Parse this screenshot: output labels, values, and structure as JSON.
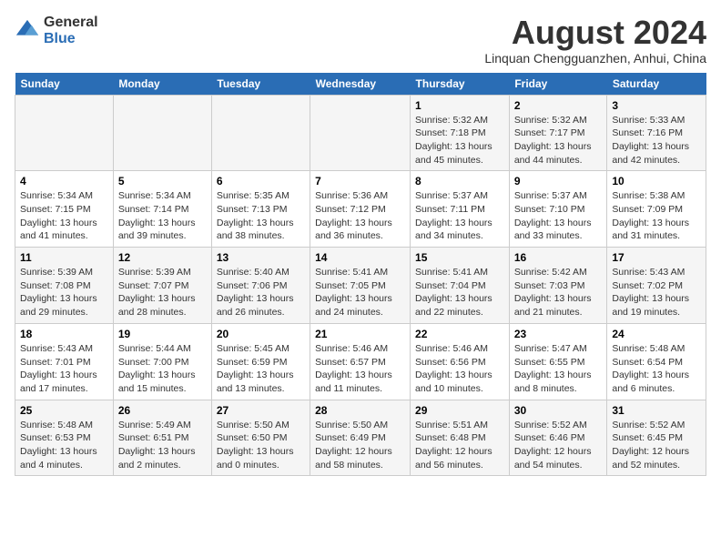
{
  "logo": {
    "general": "General",
    "blue": "Blue"
  },
  "title": {
    "month_year": "August 2024",
    "location": "Linquan Chengguanzhen, Anhui, China"
  },
  "headers": [
    "Sunday",
    "Monday",
    "Tuesday",
    "Wednesday",
    "Thursday",
    "Friday",
    "Saturday"
  ],
  "weeks": [
    [
      {
        "day": "",
        "detail": ""
      },
      {
        "day": "",
        "detail": ""
      },
      {
        "day": "",
        "detail": ""
      },
      {
        "day": "",
        "detail": ""
      },
      {
        "day": "1",
        "detail": "Sunrise: 5:32 AM\nSunset: 7:18 PM\nDaylight: 13 hours\nand 45 minutes."
      },
      {
        "day": "2",
        "detail": "Sunrise: 5:32 AM\nSunset: 7:17 PM\nDaylight: 13 hours\nand 44 minutes."
      },
      {
        "day": "3",
        "detail": "Sunrise: 5:33 AM\nSunset: 7:16 PM\nDaylight: 13 hours\nand 42 minutes."
      }
    ],
    [
      {
        "day": "4",
        "detail": "Sunrise: 5:34 AM\nSunset: 7:15 PM\nDaylight: 13 hours\nand 41 minutes."
      },
      {
        "day": "5",
        "detail": "Sunrise: 5:34 AM\nSunset: 7:14 PM\nDaylight: 13 hours\nand 39 minutes."
      },
      {
        "day": "6",
        "detail": "Sunrise: 5:35 AM\nSunset: 7:13 PM\nDaylight: 13 hours\nand 38 minutes."
      },
      {
        "day": "7",
        "detail": "Sunrise: 5:36 AM\nSunset: 7:12 PM\nDaylight: 13 hours\nand 36 minutes."
      },
      {
        "day": "8",
        "detail": "Sunrise: 5:37 AM\nSunset: 7:11 PM\nDaylight: 13 hours\nand 34 minutes."
      },
      {
        "day": "9",
        "detail": "Sunrise: 5:37 AM\nSunset: 7:10 PM\nDaylight: 13 hours\nand 33 minutes."
      },
      {
        "day": "10",
        "detail": "Sunrise: 5:38 AM\nSunset: 7:09 PM\nDaylight: 13 hours\nand 31 minutes."
      }
    ],
    [
      {
        "day": "11",
        "detail": "Sunrise: 5:39 AM\nSunset: 7:08 PM\nDaylight: 13 hours\nand 29 minutes."
      },
      {
        "day": "12",
        "detail": "Sunrise: 5:39 AM\nSunset: 7:07 PM\nDaylight: 13 hours\nand 28 minutes."
      },
      {
        "day": "13",
        "detail": "Sunrise: 5:40 AM\nSunset: 7:06 PM\nDaylight: 13 hours\nand 26 minutes."
      },
      {
        "day": "14",
        "detail": "Sunrise: 5:41 AM\nSunset: 7:05 PM\nDaylight: 13 hours\nand 24 minutes."
      },
      {
        "day": "15",
        "detail": "Sunrise: 5:41 AM\nSunset: 7:04 PM\nDaylight: 13 hours\nand 22 minutes."
      },
      {
        "day": "16",
        "detail": "Sunrise: 5:42 AM\nSunset: 7:03 PM\nDaylight: 13 hours\nand 21 minutes."
      },
      {
        "day": "17",
        "detail": "Sunrise: 5:43 AM\nSunset: 7:02 PM\nDaylight: 13 hours\nand 19 minutes."
      }
    ],
    [
      {
        "day": "18",
        "detail": "Sunrise: 5:43 AM\nSunset: 7:01 PM\nDaylight: 13 hours\nand 17 minutes."
      },
      {
        "day": "19",
        "detail": "Sunrise: 5:44 AM\nSunset: 7:00 PM\nDaylight: 13 hours\nand 15 minutes."
      },
      {
        "day": "20",
        "detail": "Sunrise: 5:45 AM\nSunset: 6:59 PM\nDaylight: 13 hours\nand 13 minutes."
      },
      {
        "day": "21",
        "detail": "Sunrise: 5:46 AM\nSunset: 6:57 PM\nDaylight: 13 hours\nand 11 minutes."
      },
      {
        "day": "22",
        "detail": "Sunrise: 5:46 AM\nSunset: 6:56 PM\nDaylight: 13 hours\nand 10 minutes."
      },
      {
        "day": "23",
        "detail": "Sunrise: 5:47 AM\nSunset: 6:55 PM\nDaylight: 13 hours\nand 8 minutes."
      },
      {
        "day": "24",
        "detail": "Sunrise: 5:48 AM\nSunset: 6:54 PM\nDaylight: 13 hours\nand 6 minutes."
      }
    ],
    [
      {
        "day": "25",
        "detail": "Sunrise: 5:48 AM\nSunset: 6:53 PM\nDaylight: 13 hours\nand 4 minutes."
      },
      {
        "day": "26",
        "detail": "Sunrise: 5:49 AM\nSunset: 6:51 PM\nDaylight: 13 hours\nand 2 minutes."
      },
      {
        "day": "27",
        "detail": "Sunrise: 5:50 AM\nSunset: 6:50 PM\nDaylight: 13 hours\nand 0 minutes."
      },
      {
        "day": "28",
        "detail": "Sunrise: 5:50 AM\nSunset: 6:49 PM\nDaylight: 12 hours\nand 58 minutes."
      },
      {
        "day": "29",
        "detail": "Sunrise: 5:51 AM\nSunset: 6:48 PM\nDaylight: 12 hours\nand 56 minutes."
      },
      {
        "day": "30",
        "detail": "Sunrise: 5:52 AM\nSunset: 6:46 PM\nDaylight: 12 hours\nand 54 minutes."
      },
      {
        "day": "31",
        "detail": "Sunrise: 5:52 AM\nSunset: 6:45 PM\nDaylight: 12 hours\nand 52 minutes."
      }
    ]
  ]
}
